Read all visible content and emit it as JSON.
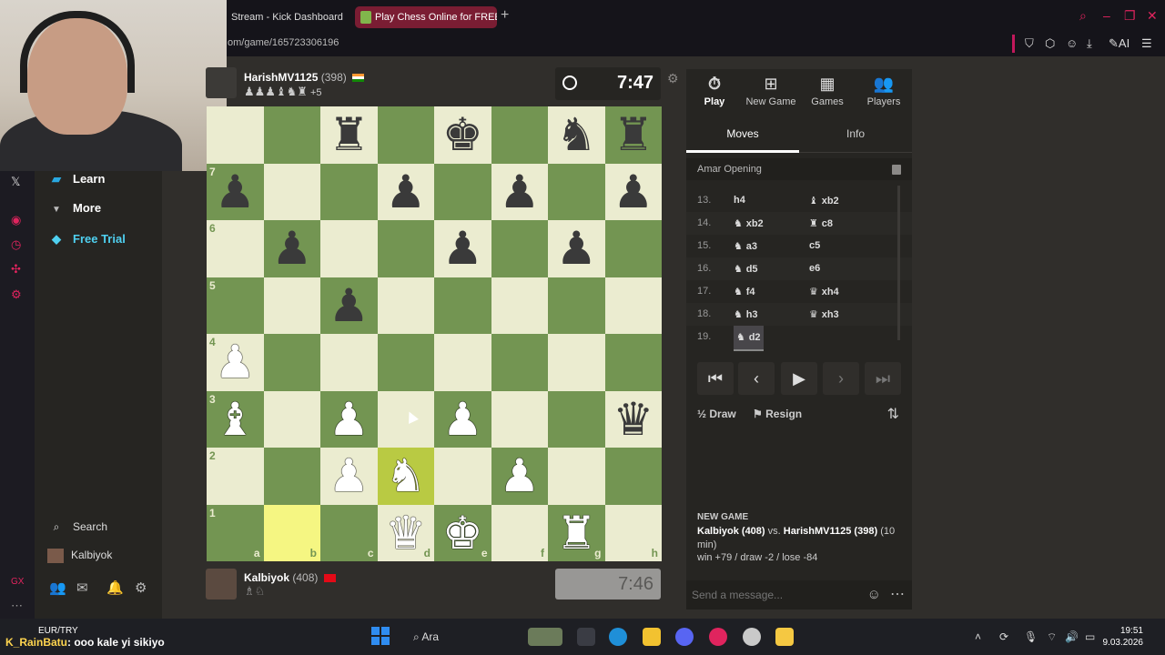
{
  "browser": {
    "tabs": [
      {
        "label": "Stream - Kick Dashboard"
      },
      {
        "label": "Play Chess Online for FREE"
      }
    ],
    "url": "om/game/165723306196",
    "toolbar_ai": "AI"
  },
  "sidebar": {
    "items": [
      {
        "label": "Learn"
      },
      {
        "label": "More"
      },
      {
        "label": "Free Trial"
      },
      {
        "label": "Search"
      },
      {
        "label": "Kalbiyok"
      }
    ]
  },
  "top_player": {
    "name": "HarishMV1125",
    "rating": "(398)",
    "captured_extra": "+5",
    "clock": "7:47"
  },
  "bottom_player": {
    "name": "Kalbiyok",
    "rating": "(408)",
    "clock": "7:46"
  },
  "board": {
    "ranks": [
      "8",
      "7",
      "6",
      "5",
      "4",
      "3",
      "2",
      "1"
    ],
    "files": [
      "a",
      "b",
      "c",
      "d",
      "e",
      "f",
      "g",
      "h"
    ],
    "rank_labels": {
      "7": "7",
      "6": "6",
      "5": "5",
      "4": "4",
      "3": "3",
      "2": "2",
      "1": "1"
    },
    "file_labels": {
      "a": "a",
      "b": "b",
      "c": "c",
      "d": "d",
      "e": "e",
      "f": "f",
      "g": "g",
      "h": "h"
    },
    "position": [
      [
        "",
        "",
        "bR",
        "",
        "bK",
        "",
        "bN",
        "bR"
      ],
      [
        "bP",
        "",
        "",
        "bP",
        "",
        "bP",
        "",
        "bP"
      ],
      [
        "",
        "bP",
        "",
        "",
        "bP",
        "",
        "bP",
        ""
      ],
      [
        "",
        "",
        "bP",
        "",
        "",
        "",
        "",
        ""
      ],
      [
        "wP",
        "",
        "",
        "",
        "",
        "",
        "",
        ""
      ],
      [
        "wB",
        "",
        "wP",
        "",
        "wP",
        "",
        "",
        "bQ"
      ],
      [
        "",
        "",
        "wP",
        "wN",
        "",
        "wP",
        "",
        ""
      ],
      [
        "",
        "",
        "",
        "wQ",
        "wK",
        "",
        "wR",
        ""
      ]
    ],
    "highlighted": [
      "b1",
      "d2"
    ]
  },
  "panel": {
    "tabs": [
      {
        "label": "Play",
        "icon": "stopwatch-icon"
      },
      {
        "label": "New Game",
        "icon": "plus-icon"
      },
      {
        "label": "Games",
        "icon": "games-icon"
      },
      {
        "label": "Players",
        "icon": "players-icon"
      }
    ],
    "subtabs": [
      {
        "label": "Moves"
      },
      {
        "label": "Info"
      }
    ],
    "opening": "Amar Opening",
    "moves": [
      {
        "num": "13.",
        "white": "h4",
        "black": "xb2",
        "black_piece": "bishop"
      },
      {
        "num": "14.",
        "white": "xb2",
        "white_piece": "knight",
        "black": "c8",
        "black_piece": "rook"
      },
      {
        "num": "15.",
        "white": "a3",
        "white_piece": "knight",
        "black": "c5"
      },
      {
        "num": "16.",
        "white": "d5",
        "white_piece": "knight",
        "black": "e6"
      },
      {
        "num": "17.",
        "white": "f4",
        "white_piece": "knight",
        "black": "xh4",
        "black_piece": "queen"
      },
      {
        "num": "18.",
        "white": "h3",
        "white_piece": "knight",
        "black": "xh3",
        "black_piece": "queen"
      },
      {
        "num": "19.",
        "white": "d2",
        "white_piece": "knight",
        "black": ""
      }
    ],
    "draw_label": "Draw",
    "resign_label": "Resign",
    "new_game": {
      "title": "NEW GAME",
      "white": "Kalbiyok (408)",
      "vs": "vs.",
      "black": "HarishMV1125 (398)",
      "time": "(10 min)",
      "stats": "win +79 / draw -2 / lose -84"
    },
    "chat_placeholder": "Send a message..."
  },
  "overlay": {
    "ticker": "EUR/TRY",
    "chat_user": "K_RainBatu",
    "chat_msg": ": ooo kale yi sikiyo"
  },
  "taskbar": {
    "search_label": "Ara",
    "time": "19:51",
    "date": "9.03.2026"
  }
}
